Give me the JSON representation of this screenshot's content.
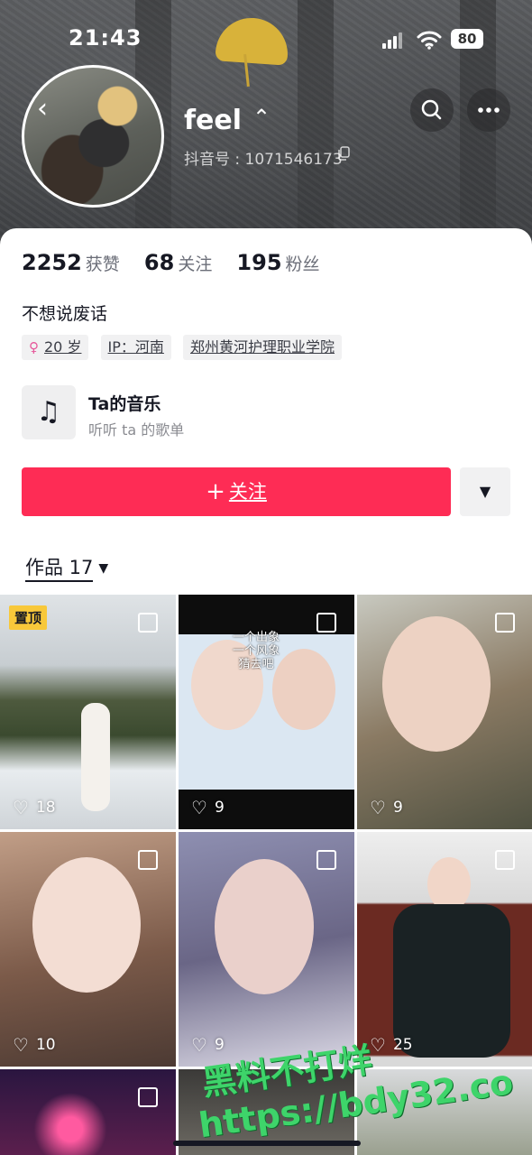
{
  "status_bar": {
    "time": "21:43",
    "battery": "80"
  },
  "profile": {
    "username": "feel",
    "douyin_id": "抖音号 : 1071546173",
    "bio": "不想说废话",
    "stats": [
      {
        "value": "2252",
        "label": "获赞"
      },
      {
        "value": "68",
        "label": "关注"
      },
      {
        "value": "195",
        "label": "粉丝"
      }
    ],
    "tags": [
      {
        "text": "20 岁",
        "icon": "female-icon"
      },
      {
        "text": "IP：河南"
      },
      {
        "text": "郑州黄河护理职业学院"
      }
    ]
  },
  "music": {
    "title": "Ta的音乐",
    "subtitle": "听听 ta 的歌单",
    "icon": "music-note-icon"
  },
  "actions": {
    "follow_plus": "+",
    "follow_label": "关注"
  },
  "works_tab": {
    "label": "作品 17"
  },
  "videos": [
    {
      "likes": "18",
      "pinned_label": "置顶"
    },
    {
      "likes": "9",
      "overlay_text": [
        "一个出象",
        "一个风象",
        "猜去吧"
      ]
    },
    {
      "likes": "9"
    },
    {
      "likes": "10"
    },
    {
      "likes": "9"
    },
    {
      "likes": "25"
    },
    {
      "likes": ""
    },
    {
      "likes": ""
    },
    {
      "likes": ""
    }
  ],
  "watermark": {
    "line1": "黑料不打烊",
    "line2": "https://bdy32.co"
  },
  "colors": {
    "accent": "#fe2c55",
    "pin_badge": "#f8c83a",
    "watermark": "#3ed46a"
  }
}
